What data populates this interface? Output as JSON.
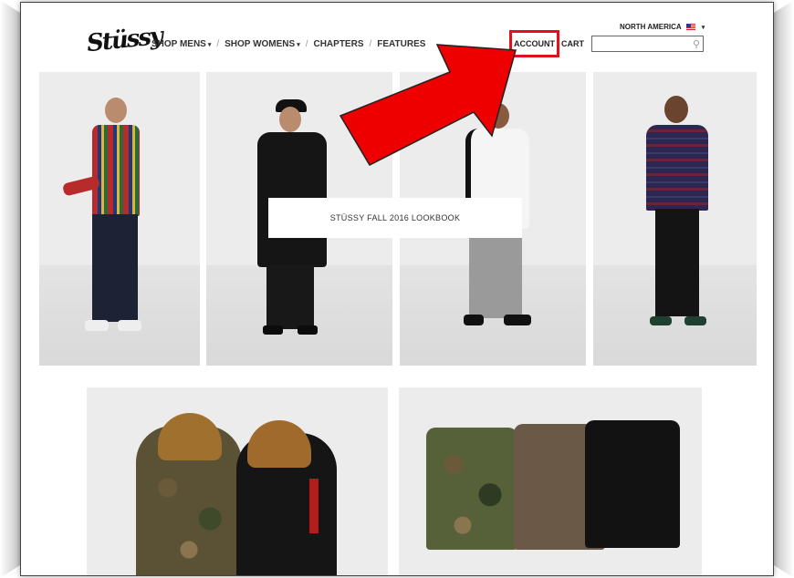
{
  "site": {
    "logo_text": "Stüssy",
    "nav": [
      {
        "label": "SHOP MENS",
        "has_caret": true
      },
      {
        "label": "SHOP WOMENS",
        "has_caret": true
      },
      {
        "label": "CHAPTERS",
        "has_caret": false
      },
      {
        "label": "FEATURES",
        "has_caret": false
      }
    ],
    "region": "NORTH AMERICA",
    "account_label": "ACCOUNT",
    "cart_label": "CART",
    "search": {
      "placeholder": "",
      "value": ""
    }
  },
  "hero": {
    "banner_label": "STÜSSY FALL 2016 LOOKBOOK"
  },
  "colors": {
    "highlight": "#e0101c",
    "arrow": "#ee0000",
    "tile_bg": "#ececec"
  },
  "icons": [
    "search-icon",
    "chevron-down-icon",
    "us-flag-icon",
    "red-arrow-annotation"
  ]
}
